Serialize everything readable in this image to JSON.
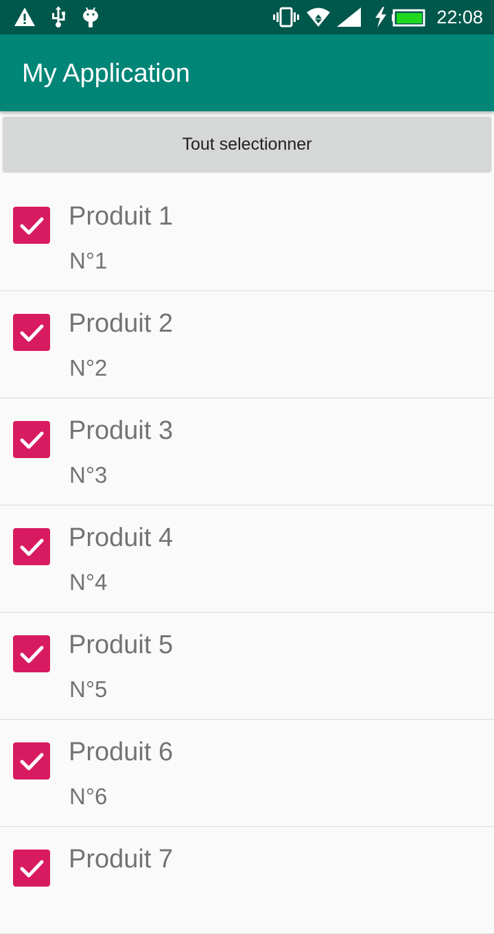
{
  "status_bar": {
    "time": "22:08",
    "icons": [
      "warning-icon",
      "usb-icon",
      "android-debug-icon",
      "vibrate-icon",
      "wifi-icon",
      "cell-signal-icon",
      "battery-charging-icon"
    ]
  },
  "app_bar": {
    "title": "My Application"
  },
  "select_all_label": "Tout selectionner",
  "products": [
    {
      "name": "Produit 1",
      "number": "N°1",
      "checked": true
    },
    {
      "name": "Produit 2",
      "number": "N°2",
      "checked": true
    },
    {
      "name": "Produit 3",
      "number": "N°3",
      "checked": true
    },
    {
      "name": "Produit 4",
      "number": "N°4",
      "checked": true
    },
    {
      "name": "Produit 5",
      "number": "N°5",
      "checked": true
    },
    {
      "name": "Produit 6",
      "number": "N°6",
      "checked": true
    },
    {
      "name": "Produit 7",
      "number": "",
      "checked": true
    }
  ],
  "colors": {
    "status_bar": "#00574b",
    "primary": "#008577",
    "accent": "#d81b60",
    "battery_fill": "#20d820"
  }
}
